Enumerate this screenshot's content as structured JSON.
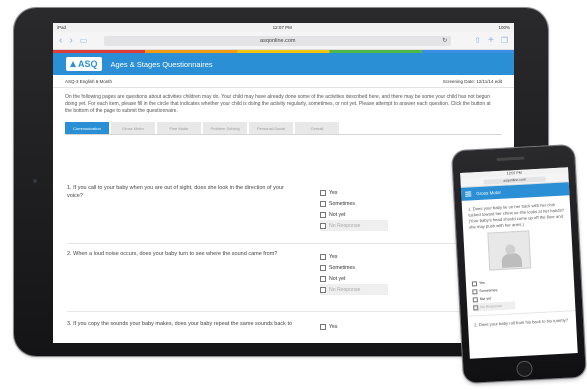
{
  "tablet": {
    "status": {
      "carrier": "iPad",
      "time": "12:07 PM",
      "battery": "100%"
    },
    "browser": {
      "url": "asqonline.com"
    },
    "app": {
      "logo_text": "ASQ",
      "title": "Ages & Stages Questionnaires"
    },
    "subheader": {
      "form_name": "ASQ-3 English 6 Month",
      "screening_date": "Screening Date: 12/11/14 edit"
    },
    "intro": "On the following pages are questions about activities children may do. Your child may have already done some of the activities described here, and there may be some your child has not begun doing yet. For each item, please fill in the circle that indicates whether your child is doing the activity regularly, sometimes, or not yet. Please attempt to answer each question. Click the button at the bottom of the page to submit the questionnaire.",
    "tabs": [
      "Communication",
      "Gross Motor",
      "Fine Motor",
      "Problem Solving",
      "Personal-Social",
      "Overall"
    ],
    "questions": [
      {
        "number": "1.",
        "text": "If you call to your baby when you are out of sight, does she look in the direction of your voice?"
      },
      {
        "number": "2.",
        "text": "When a loud noise occurs, does your baby turn to see where the sound came from?"
      },
      {
        "number": "3.",
        "text": "If you copy the sounds your baby makes, does your baby repeat the same sounds back to"
      }
    ],
    "options": [
      "Yes",
      "Sometimes",
      "Not yet",
      "No Response"
    ]
  },
  "phone": {
    "status": {
      "time": "12:07 PM"
    },
    "browser": {
      "url": "asqonline.com"
    },
    "app_title": "Gross Motor",
    "question1": "1. Does your baby lie on her back with her chin tucked toward her chest so she looks at her hands? (Your baby's head should come up off the floor and she may push with her arms.)",
    "options": [
      "Yes",
      "Sometimes",
      "Not yet",
      "No Response"
    ],
    "question2": "2. Does your baby roll from his back to his tummy?"
  },
  "colors": {
    "brand_blue": "#2b8fd6",
    "device_black": "#1b1b1d"
  }
}
